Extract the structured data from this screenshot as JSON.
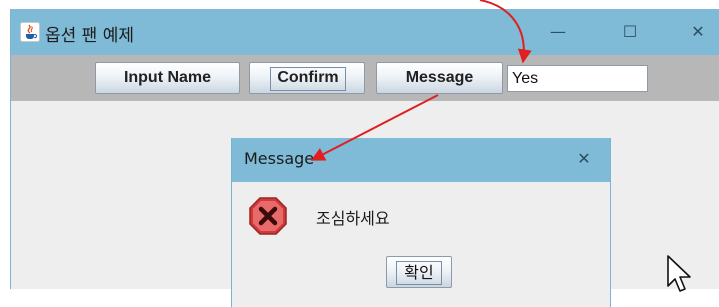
{
  "window": {
    "title": "옵션 팬 예제",
    "icon": "java-coffee-icon",
    "controls": {
      "minimize": "—",
      "maximize": "☐",
      "close": "✕"
    }
  },
  "toolbar": {
    "input_name_label": "Input Name",
    "confirm_label": "Confirm",
    "message_label": "Message",
    "name_field_value": "Yes"
  },
  "dialog": {
    "title": "Message",
    "close": "✕",
    "icon": "error-icon",
    "message": "조심하세요",
    "ok_label": "확인"
  },
  "colors": {
    "title_bar": "#7fbad7",
    "toolbar": "#b7b7b7",
    "content": "#eeeeee",
    "annotation_arrow": "#e02020",
    "error_icon": "#d23a3a"
  }
}
